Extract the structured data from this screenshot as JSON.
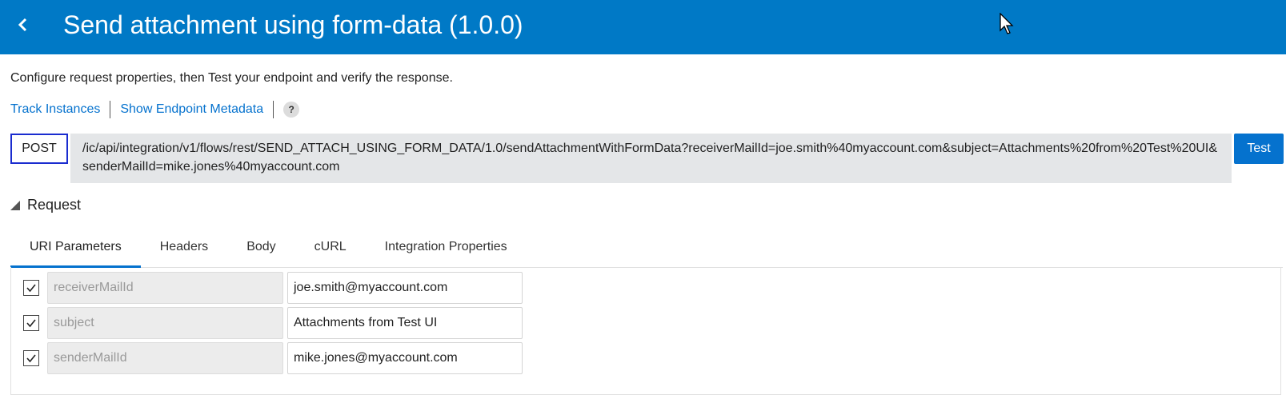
{
  "header": {
    "title": "Send attachment using form-data (1.0.0)",
    "background_color": "#0079c6",
    "back_icon": "chevron-left-icon"
  },
  "intro_text": "Configure request properties, then Test your endpoint and verify the response.",
  "links": {
    "track_instances": "Track Instances",
    "show_endpoint_metadata": "Show Endpoint Metadata",
    "help": "?"
  },
  "request_bar": {
    "method": "POST",
    "url": "/ic/api/integration/v1/flows/rest/SEND_ATTACH_USING_FORM_DATA/1.0/sendAttachmentWithFormData?receiverMailId=joe.smith%40myaccount.com&subject=Attachments%20from%20Test%20UI&senderMailId=mike.jones%40myaccount.com",
    "test_label": "Test",
    "accent_color": "#0572ce"
  },
  "request_section": {
    "title": "Request",
    "expanded": true
  },
  "tabs": [
    {
      "label": "URI Parameters",
      "active": true
    },
    {
      "label": "Headers",
      "active": false
    },
    {
      "label": "Body",
      "active": false
    },
    {
      "label": "cURL",
      "active": false
    },
    {
      "label": "Integration Properties",
      "active": false
    }
  ],
  "uri_parameters": [
    {
      "name": "receiverMailId",
      "value": "joe.smith@myaccount.com",
      "checked": true
    },
    {
      "name": "subject",
      "value": "Attachments from Test UI",
      "checked": true
    },
    {
      "name": "senderMailId",
      "value": "mike.jones@myaccount.com",
      "checked": true
    }
  ]
}
